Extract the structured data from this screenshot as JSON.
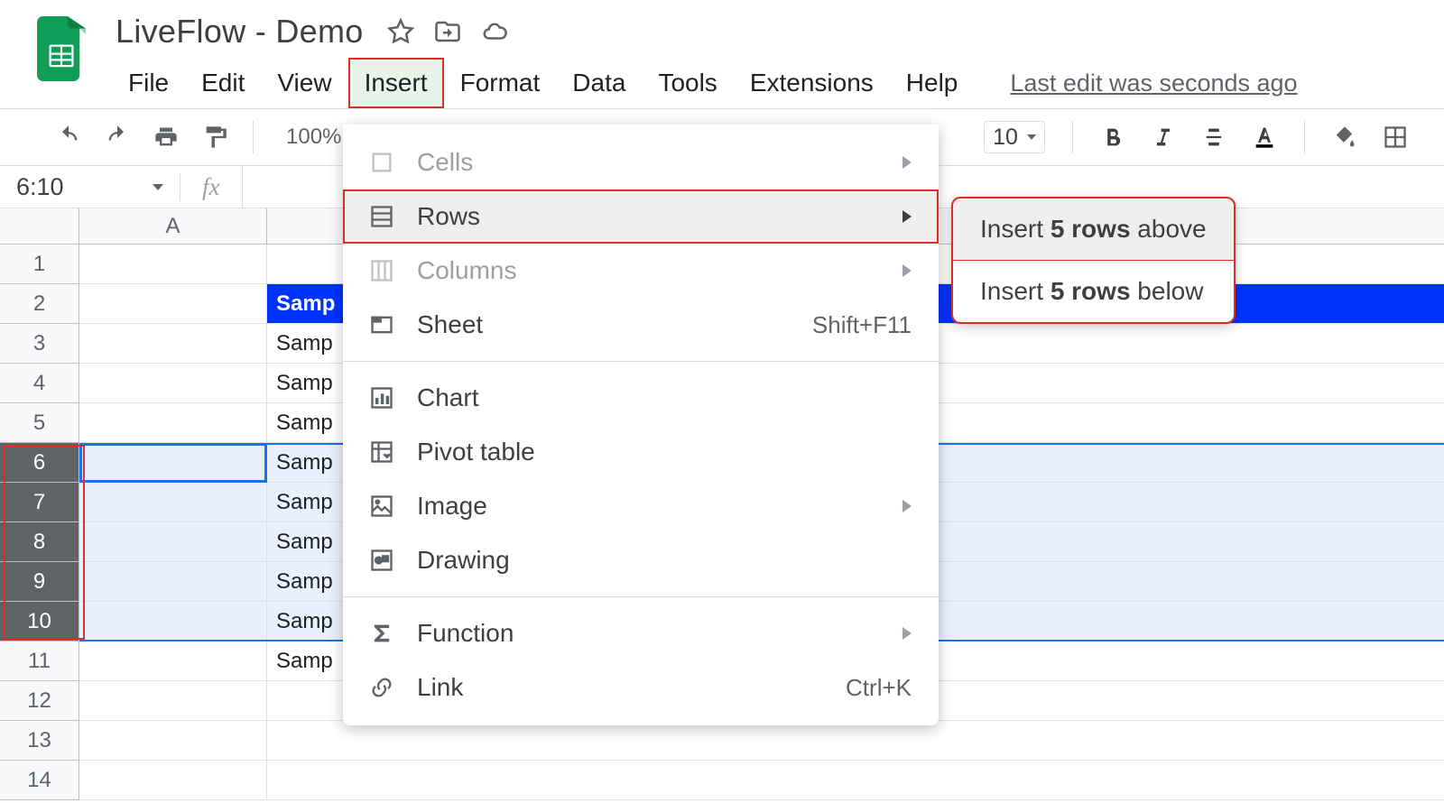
{
  "doc": {
    "title": "LiveFlow - Demo"
  },
  "menu": {
    "file": "File",
    "edit": "Edit",
    "view": "View",
    "insert": "Insert",
    "format": "Format",
    "data": "Data",
    "tools": "Tools",
    "extensions": "Extensions",
    "help": "Help",
    "last_edit": "Last edit was seconds ago"
  },
  "toolbar": {
    "zoom": "100%",
    "font_size": "10"
  },
  "namebox": {
    "value": "6:10"
  },
  "fx_label": "fx",
  "columns": [
    "A"
  ],
  "rows": [
    "1",
    "2",
    "3",
    "4",
    "5",
    "6",
    "7",
    "8",
    "9",
    "10",
    "11",
    "12",
    "13",
    "14"
  ],
  "selected_rows_start": 6,
  "selected_rows_end": 10,
  "cells": {
    "B2": "Samp",
    "B3": "Samp",
    "B4": "Samp",
    "B5": "Samp",
    "B6": "Samp",
    "B7": "Samp",
    "B8": "Samp",
    "B9": "Samp",
    "B10": "Samp",
    "B11": "Samp"
  },
  "insert_menu": {
    "cells": "Cells",
    "rows": "Rows",
    "columns": "Columns",
    "sheet": "Sheet",
    "sheet_shortcut": "Shift+F11",
    "chart": "Chart",
    "pivot": "Pivot table",
    "image": "Image",
    "drawing": "Drawing",
    "function": "Function",
    "link": "Link",
    "link_shortcut": "Ctrl+K"
  },
  "submenu": {
    "above_prefix": "Insert ",
    "above_bold": "5 rows",
    "above_suffix": " above",
    "below_prefix": "Insert ",
    "below_bold": "5 rows",
    "below_suffix": " below"
  }
}
